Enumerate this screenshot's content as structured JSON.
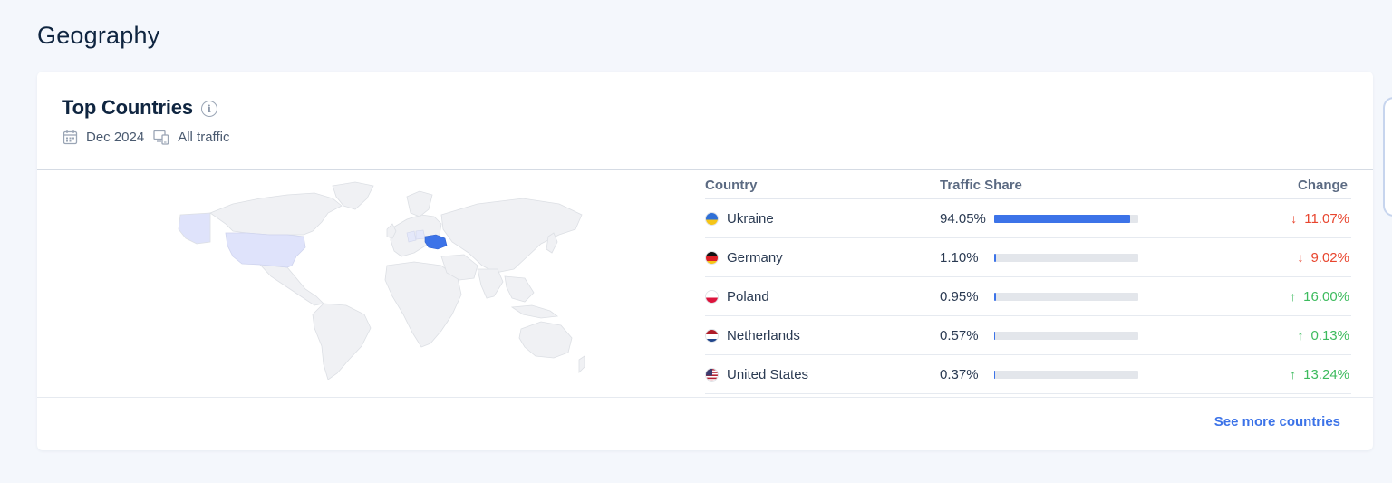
{
  "page": {
    "title": "Geography"
  },
  "card": {
    "title": "Top Countries",
    "info_icon": "info-icon",
    "meta": {
      "date": "Dec 2024",
      "date_icon": "calendar-icon",
      "traffic": "All traffic",
      "traffic_icon": "devices-icon"
    },
    "see_more": "See more countries"
  },
  "colors": {
    "accent": "#3c73e8",
    "down": "#e8452e",
    "up": "#3dbb5e",
    "highlight_country": "#3c73e8",
    "secondary_country": "#dfe3fb"
  },
  "table": {
    "headers": {
      "country": "Country",
      "share": "Traffic Share",
      "change": "Change"
    },
    "rows": [
      {
        "country": "Ukraine",
        "flag": "ukraine-flag-icon",
        "share": "94.05%",
        "share_fraction": 0.9405,
        "change": "11.07%",
        "direction": "down"
      },
      {
        "country": "Germany",
        "flag": "germany-flag-icon",
        "share": "1.10%",
        "share_fraction": 0.011,
        "change": "9.02%",
        "direction": "down"
      },
      {
        "country": "Poland",
        "flag": "poland-flag-icon",
        "share": "0.95%",
        "share_fraction": 0.0095,
        "change": "16.00%",
        "direction": "up"
      },
      {
        "country": "Netherlands",
        "flag": "netherlands-flag-icon",
        "share": "0.57%",
        "share_fraction": 0.0057,
        "change": "0.13%",
        "direction": "up"
      },
      {
        "country": "United States",
        "flag": "united-states-flag-icon",
        "share": "0.37%",
        "share_fraction": 0.0037,
        "change": "13.24%",
        "direction": "up"
      }
    ]
  }
}
